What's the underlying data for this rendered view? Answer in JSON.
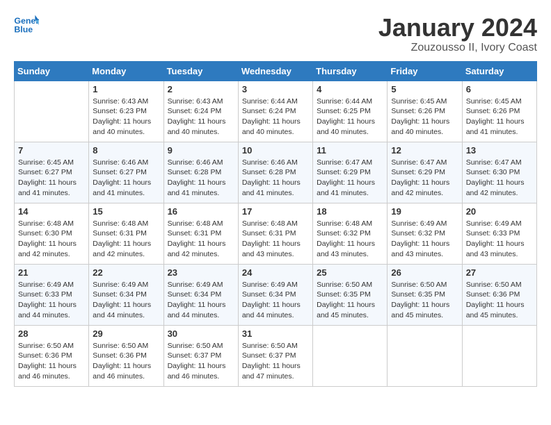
{
  "header": {
    "logo_line1": "General",
    "logo_line2": "Blue",
    "title": "January 2024",
    "subtitle": "Zouzousso II, Ivory Coast"
  },
  "days_of_week": [
    "Sunday",
    "Monday",
    "Tuesday",
    "Wednesday",
    "Thursday",
    "Friday",
    "Saturday"
  ],
  "weeks": [
    [
      {
        "day": "",
        "sunrise": "",
        "sunset": "",
        "daylight": ""
      },
      {
        "day": "1",
        "sunrise": "Sunrise: 6:43 AM",
        "sunset": "Sunset: 6:23 PM",
        "daylight": "Daylight: 11 hours and 40 minutes."
      },
      {
        "day": "2",
        "sunrise": "Sunrise: 6:43 AM",
        "sunset": "Sunset: 6:24 PM",
        "daylight": "Daylight: 11 hours and 40 minutes."
      },
      {
        "day": "3",
        "sunrise": "Sunrise: 6:44 AM",
        "sunset": "Sunset: 6:24 PM",
        "daylight": "Daylight: 11 hours and 40 minutes."
      },
      {
        "day": "4",
        "sunrise": "Sunrise: 6:44 AM",
        "sunset": "Sunset: 6:25 PM",
        "daylight": "Daylight: 11 hours and 40 minutes."
      },
      {
        "day": "5",
        "sunrise": "Sunrise: 6:45 AM",
        "sunset": "Sunset: 6:26 PM",
        "daylight": "Daylight: 11 hours and 40 minutes."
      },
      {
        "day": "6",
        "sunrise": "Sunrise: 6:45 AM",
        "sunset": "Sunset: 6:26 PM",
        "daylight": "Daylight: 11 hours and 41 minutes."
      }
    ],
    [
      {
        "day": "7",
        "sunrise": "Sunrise: 6:45 AM",
        "sunset": "Sunset: 6:27 PM",
        "daylight": "Daylight: 11 hours and 41 minutes."
      },
      {
        "day": "8",
        "sunrise": "Sunrise: 6:46 AM",
        "sunset": "Sunset: 6:27 PM",
        "daylight": "Daylight: 11 hours and 41 minutes."
      },
      {
        "day": "9",
        "sunrise": "Sunrise: 6:46 AM",
        "sunset": "Sunset: 6:28 PM",
        "daylight": "Daylight: 11 hours and 41 minutes."
      },
      {
        "day": "10",
        "sunrise": "Sunrise: 6:46 AM",
        "sunset": "Sunset: 6:28 PM",
        "daylight": "Daylight: 11 hours and 41 minutes."
      },
      {
        "day": "11",
        "sunrise": "Sunrise: 6:47 AM",
        "sunset": "Sunset: 6:29 PM",
        "daylight": "Daylight: 11 hours and 41 minutes."
      },
      {
        "day": "12",
        "sunrise": "Sunrise: 6:47 AM",
        "sunset": "Sunset: 6:29 PM",
        "daylight": "Daylight: 11 hours and 42 minutes."
      },
      {
        "day": "13",
        "sunrise": "Sunrise: 6:47 AM",
        "sunset": "Sunset: 6:30 PM",
        "daylight": "Daylight: 11 hours and 42 minutes."
      }
    ],
    [
      {
        "day": "14",
        "sunrise": "Sunrise: 6:48 AM",
        "sunset": "Sunset: 6:30 PM",
        "daylight": "Daylight: 11 hours and 42 minutes."
      },
      {
        "day": "15",
        "sunrise": "Sunrise: 6:48 AM",
        "sunset": "Sunset: 6:31 PM",
        "daylight": "Daylight: 11 hours and 42 minutes."
      },
      {
        "day": "16",
        "sunrise": "Sunrise: 6:48 AM",
        "sunset": "Sunset: 6:31 PM",
        "daylight": "Daylight: 11 hours and 42 minutes."
      },
      {
        "day": "17",
        "sunrise": "Sunrise: 6:48 AM",
        "sunset": "Sunset: 6:31 PM",
        "daylight": "Daylight: 11 hours and 43 minutes."
      },
      {
        "day": "18",
        "sunrise": "Sunrise: 6:48 AM",
        "sunset": "Sunset: 6:32 PM",
        "daylight": "Daylight: 11 hours and 43 minutes."
      },
      {
        "day": "19",
        "sunrise": "Sunrise: 6:49 AM",
        "sunset": "Sunset: 6:32 PM",
        "daylight": "Daylight: 11 hours and 43 minutes."
      },
      {
        "day": "20",
        "sunrise": "Sunrise: 6:49 AM",
        "sunset": "Sunset: 6:33 PM",
        "daylight": "Daylight: 11 hours and 43 minutes."
      }
    ],
    [
      {
        "day": "21",
        "sunrise": "Sunrise: 6:49 AM",
        "sunset": "Sunset: 6:33 PM",
        "daylight": "Daylight: 11 hours and 44 minutes."
      },
      {
        "day": "22",
        "sunrise": "Sunrise: 6:49 AM",
        "sunset": "Sunset: 6:34 PM",
        "daylight": "Daylight: 11 hours and 44 minutes."
      },
      {
        "day": "23",
        "sunrise": "Sunrise: 6:49 AM",
        "sunset": "Sunset: 6:34 PM",
        "daylight": "Daylight: 11 hours and 44 minutes."
      },
      {
        "day": "24",
        "sunrise": "Sunrise: 6:49 AM",
        "sunset": "Sunset: 6:34 PM",
        "daylight": "Daylight: 11 hours and 44 minutes."
      },
      {
        "day": "25",
        "sunrise": "Sunrise: 6:50 AM",
        "sunset": "Sunset: 6:35 PM",
        "daylight": "Daylight: 11 hours and 45 minutes."
      },
      {
        "day": "26",
        "sunrise": "Sunrise: 6:50 AM",
        "sunset": "Sunset: 6:35 PM",
        "daylight": "Daylight: 11 hours and 45 minutes."
      },
      {
        "day": "27",
        "sunrise": "Sunrise: 6:50 AM",
        "sunset": "Sunset: 6:36 PM",
        "daylight": "Daylight: 11 hours and 45 minutes."
      }
    ],
    [
      {
        "day": "28",
        "sunrise": "Sunrise: 6:50 AM",
        "sunset": "Sunset: 6:36 PM",
        "daylight": "Daylight: 11 hours and 46 minutes."
      },
      {
        "day": "29",
        "sunrise": "Sunrise: 6:50 AM",
        "sunset": "Sunset: 6:36 PM",
        "daylight": "Daylight: 11 hours and 46 minutes."
      },
      {
        "day": "30",
        "sunrise": "Sunrise: 6:50 AM",
        "sunset": "Sunset: 6:37 PM",
        "daylight": "Daylight: 11 hours and 46 minutes."
      },
      {
        "day": "31",
        "sunrise": "Sunrise: 6:50 AM",
        "sunset": "Sunset: 6:37 PM",
        "daylight": "Daylight: 11 hours and 47 minutes."
      },
      {
        "day": "",
        "sunrise": "",
        "sunset": "",
        "daylight": ""
      },
      {
        "day": "",
        "sunrise": "",
        "sunset": "",
        "daylight": ""
      },
      {
        "day": "",
        "sunrise": "",
        "sunset": "",
        "daylight": ""
      }
    ]
  ]
}
